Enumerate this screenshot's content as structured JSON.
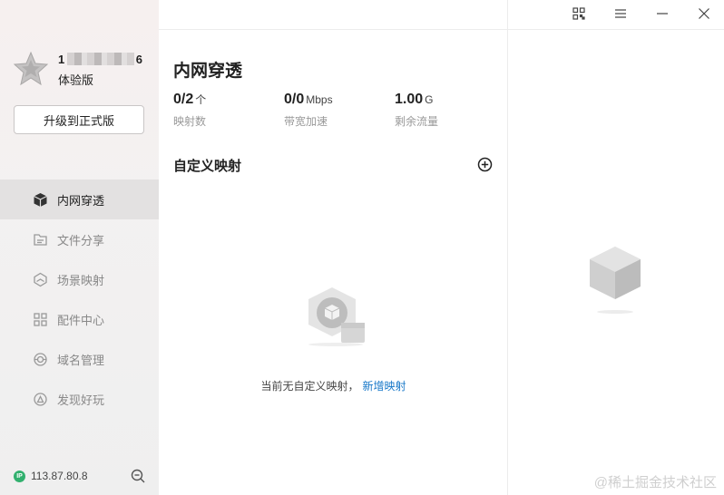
{
  "sidebar": {
    "user_prefix": "1",
    "user_suffix": "6",
    "plan": "体验版",
    "upgrade_label": "升级到正式版",
    "nav": [
      {
        "label": "内网穿透",
        "icon": "cube-icon",
        "active": true
      },
      {
        "label": "文件分享",
        "icon": "file-share-icon"
      },
      {
        "label": "场景映射",
        "icon": "scene-map-icon"
      },
      {
        "label": "配件中心",
        "icon": "grid-icon"
      },
      {
        "label": "域名管理",
        "icon": "domain-icon"
      },
      {
        "label": "发现好玩",
        "icon": "discover-icon"
      }
    ],
    "ip": "113.87.80.8",
    "ip_badge": "IP"
  },
  "main": {
    "title": "内网穿透",
    "stats": [
      {
        "value": "0/2",
        "unit": "个",
        "label": "映射数"
      },
      {
        "value": "0/0",
        "unit": "Mbps",
        "label": "带宽加速"
      },
      {
        "value": "1.00",
        "unit": "G",
        "label": "剩余流量"
      }
    ],
    "section_title": "自定义映射",
    "empty_text": "当前无自定义映射，",
    "empty_link": "新增映射"
  },
  "watermark": "@稀土掘金技术社区"
}
